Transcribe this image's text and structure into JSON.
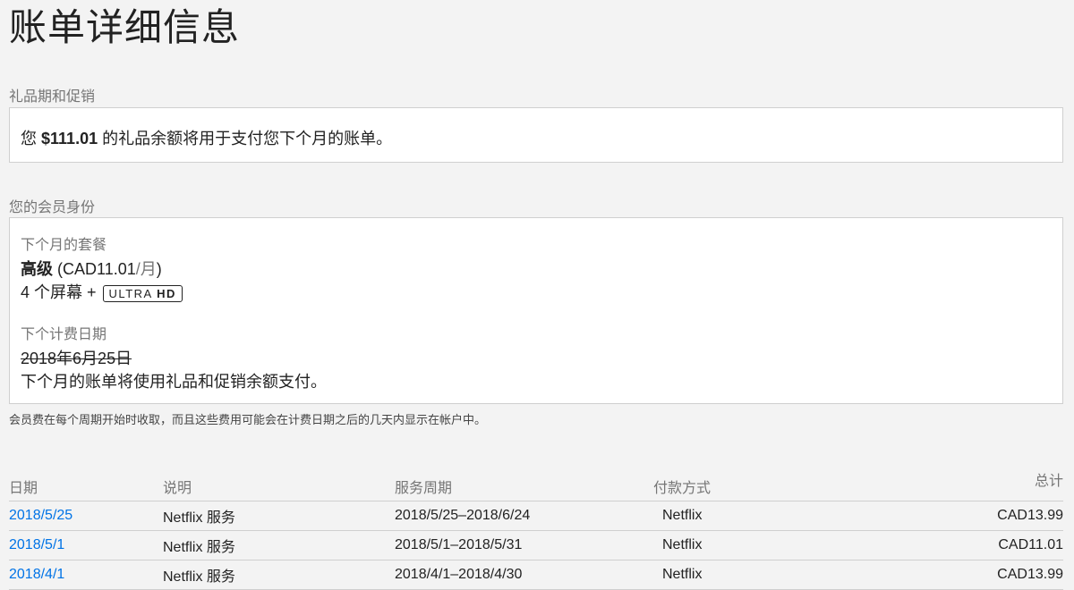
{
  "page": {
    "title": "账单详细信息"
  },
  "gift": {
    "section_label": "礼品期和促销",
    "prefix": "您",
    "amount": "$111.01",
    "suffix": "的礼品余额将用于支付您下个月的账单。"
  },
  "membership": {
    "section_label": "您的会员身份",
    "next_plan_label": "下个月的套餐",
    "plan_name": "高级",
    "plan_price_open": "(CAD11.01",
    "plan_price_slash": "/月",
    "plan_price_close": ")",
    "screens_text": "4 个屏幕 +",
    "badge_ultra": "ULTRA",
    "badge_hd": "HD",
    "next_billing_label": "下个计费日期",
    "next_billing_date": "2018年6月25日",
    "billing_note": "下个月的账单将使用礼品和促销余额支付。"
  },
  "footnote": "会员费在每个周期开始时收取，而且这些费用可能会在计费日期之后的几天内显示在帐户中。",
  "history": {
    "headers": {
      "date": "日期",
      "desc": "说明",
      "period": "服务周期",
      "payment": "付款方式",
      "total": "总计"
    },
    "rows": [
      {
        "date": "2018/5/25",
        "desc": "Netflix 服务",
        "period": "2018/5/25–2018/6/24",
        "payment": "Netflix",
        "total": "CAD13.99"
      },
      {
        "date": "2018/5/1",
        "desc": "Netflix 服务",
        "period": "2018/5/1–2018/5/31",
        "payment": "Netflix",
        "total": "CAD11.01"
      },
      {
        "date": "2018/4/1",
        "desc": "Netflix 服务",
        "period": "2018/4/1–2018/4/30",
        "payment": "Netflix",
        "total": "CAD13.99"
      }
    ]
  },
  "colors": {
    "link": "#0073e6",
    "muted": "#767676",
    "background": "#f3f3f3"
  }
}
